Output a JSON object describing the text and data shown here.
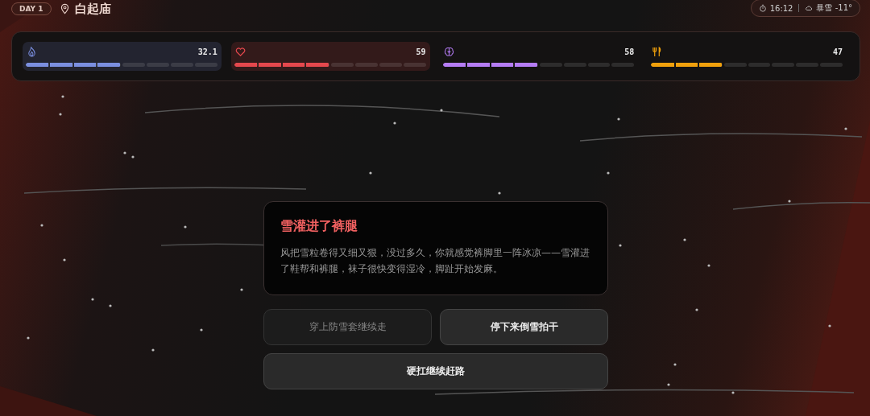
{
  "header": {
    "day": "DAY 1",
    "location": "白起庙",
    "time": "16:12",
    "weather": "暴雪 -11°"
  },
  "stats": [
    {
      "kind": "warmth",
      "value": "32.1",
      "level": 0.5,
      "color": "#7b8fe0",
      "alert": true
    },
    {
      "kind": "health",
      "value": "59",
      "level": 0.5,
      "color": "#e5484d",
      "alert": true
    },
    {
      "kind": "mind",
      "value": "58",
      "level": 0.5,
      "color": "#b57cf5",
      "alert": false
    },
    {
      "kind": "food",
      "value": "47",
      "level": 0.375,
      "color": "#f0a00c",
      "alert": false
    }
  ],
  "event": {
    "title": "雪灌进了裤腿",
    "text": "风把雪粒卷得又细又狠，没过多久，你就感觉裤脚里一阵冰凉——雪灌进了鞋帮和裤腿，袜子很快变得湿冷，脚趾开始发麻。"
  },
  "choices": [
    {
      "label": "穿上防雪套继续走",
      "disabled": true
    },
    {
      "label": "停下来倒雪拍干",
      "disabled": false
    },
    {
      "label": "硬扛继续赶路",
      "disabled": false
    }
  ]
}
